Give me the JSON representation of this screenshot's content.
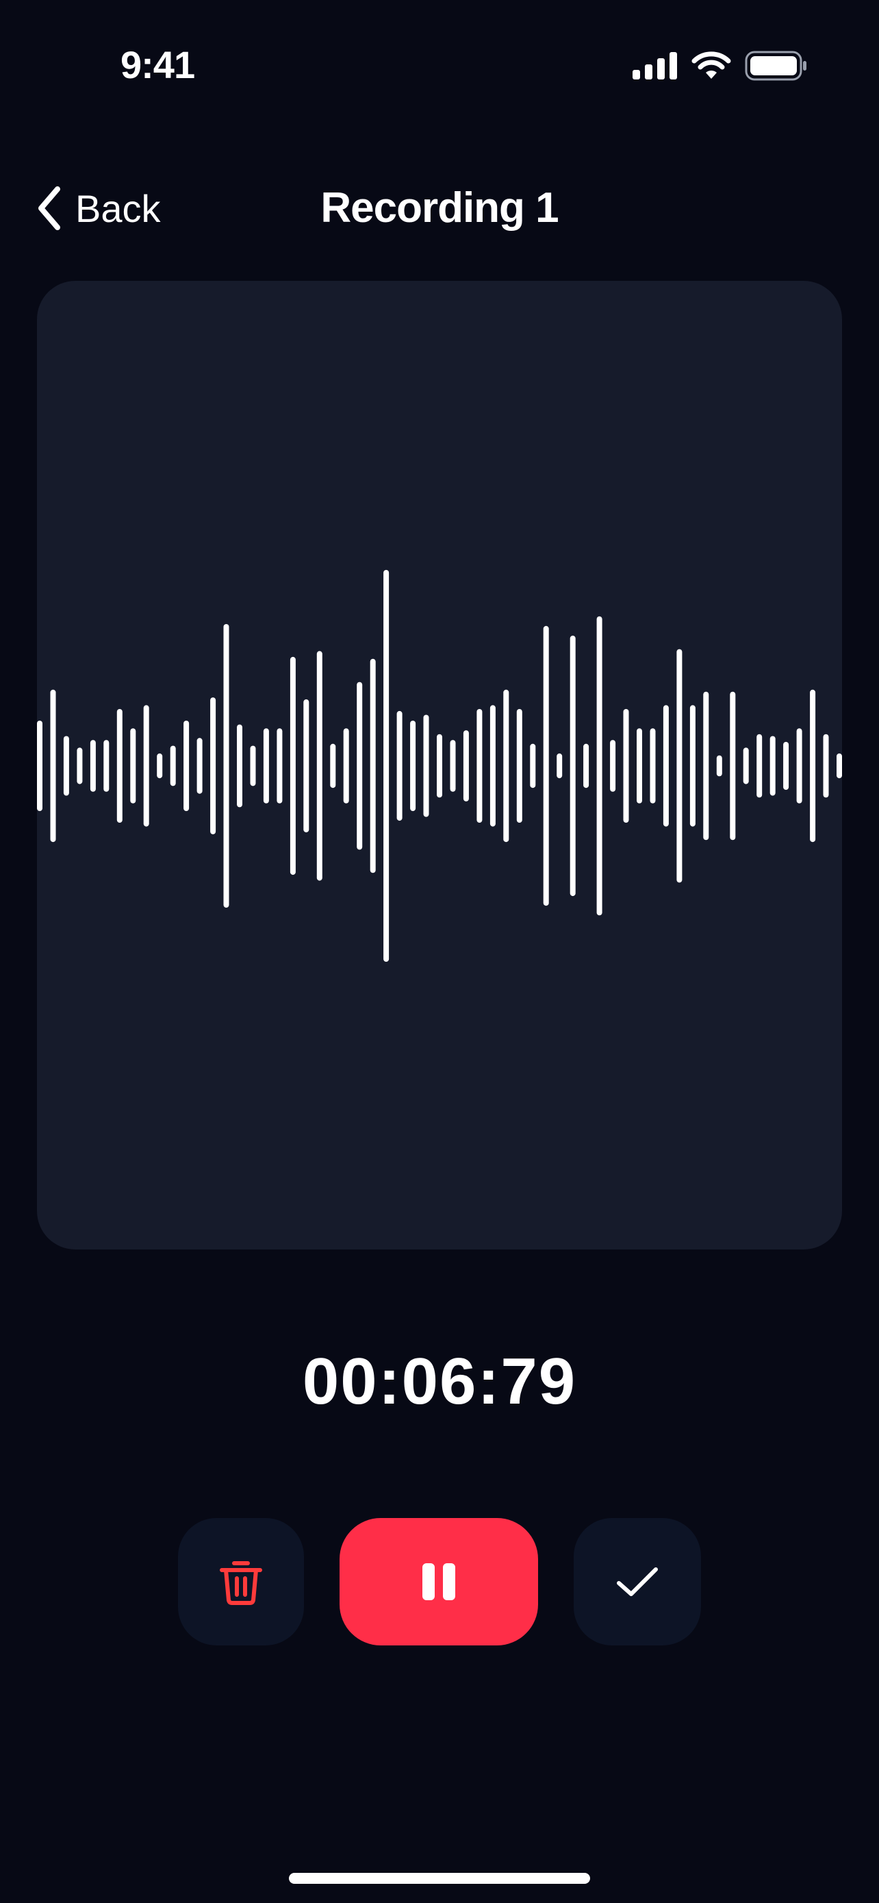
{
  "status_bar": {
    "time": "9:41",
    "icons": [
      "cellular-signal-icon",
      "wifi-icon",
      "battery-icon"
    ]
  },
  "nav": {
    "back_label": "Back",
    "back_icon": "chevron-left-icon",
    "title": "Recording 1"
  },
  "waveform": {
    "bar_color": "#ffffff",
    "card_color": "#161b2b",
    "amplitudes": [
      0.22,
      0.38,
      0.14,
      0.08,
      0.12,
      0.12,
      0.28,
      0.18,
      0.3,
      0.05,
      0.09,
      0.22,
      0.13,
      0.34,
      0.72,
      0.2,
      0.09,
      0.18,
      0.18,
      0.55,
      0.33,
      0.58,
      0.1,
      0.18,
      0.42,
      0.54,
      1.0,
      0.27,
      0.22,
      0.25,
      0.15,
      0.12,
      0.17,
      0.28,
      0.3,
      0.38,
      0.28,
      0.1,
      0.71,
      0.05,
      0.66,
      0.1,
      0.76,
      0.12,
      0.28,
      0.18,
      0.18,
      0.3,
      0.59,
      0.3,
      0.37,
      0.04,
      0.37,
      0.08,
      0.15,
      0.14,
      0.11,
      0.18,
      0.38,
      0.15,
      0.05
    ]
  },
  "timer": {
    "value": "00:06:79"
  },
  "controls": {
    "delete_icon": "trash-icon",
    "delete_color": "#ff3b3b",
    "pause_icon": "pause-icon",
    "pause_color": "#ff2e48",
    "done_icon": "checkmark-icon"
  },
  "colors": {
    "background": "#070915",
    "accent": "#ff2e48",
    "control_bg": "#0d1426"
  }
}
